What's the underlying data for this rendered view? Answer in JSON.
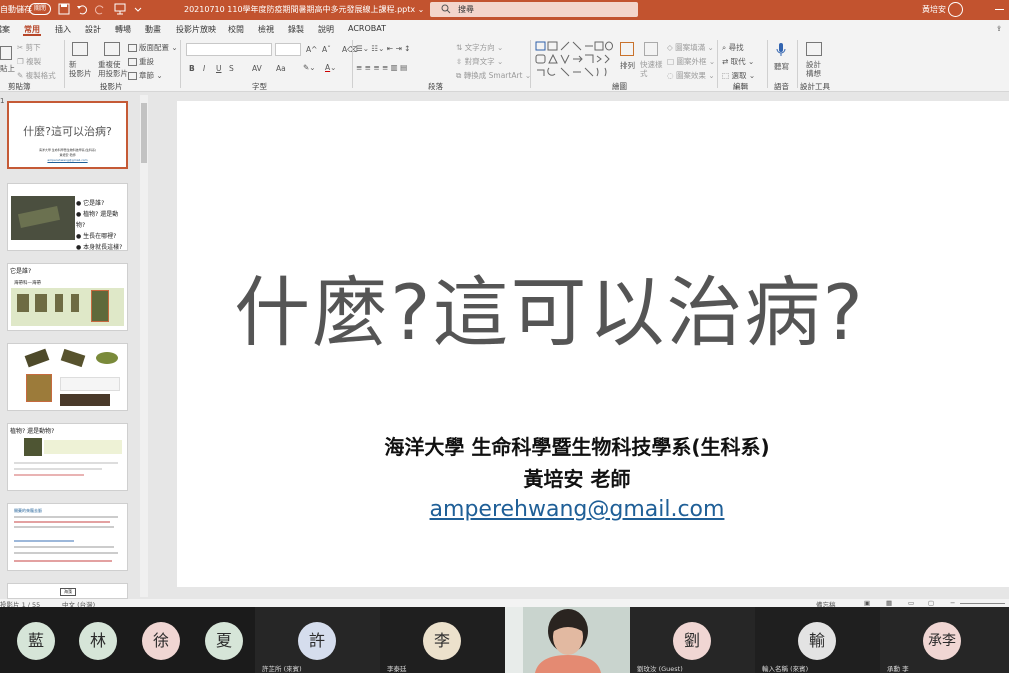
{
  "titlebar": {
    "autosave_label": "自動儲存",
    "autosave_state": "關閉",
    "document_title": "20210710 110學年度防疫期間暑期高中多元發展線上課程.pptx  ⌄",
    "search_placeholder": "搜尋",
    "user_name": "黃培安"
  },
  "tabs": [
    "檔案",
    "常用",
    "插入",
    "設計",
    "轉場",
    "動畫",
    "投影片放映",
    "校閱",
    "檢視",
    "錄製",
    "說明",
    "ACROBAT"
  ],
  "ribbon": {
    "clipboard": {
      "paste": "貼上",
      "cut": "剪下",
      "copy": "複製",
      "format_painter": "複製格式",
      "label": "剪貼簿"
    },
    "slides": {
      "new_slide": "新\n投影片",
      "reuse": "重複使\n用投影片",
      "layout": "版面配置",
      "reset": "重設",
      "section": "章節",
      "label": "投影片"
    },
    "font": {
      "bold": "B",
      "italic": "I",
      "underline": "U",
      "strike": "S",
      "spacing": "AV",
      "case": "Aa",
      "label": "字型"
    },
    "paragraph": {
      "text_direction": "文字方向",
      "align_text": "對齊文字",
      "smartart": "轉換成 SmartArt",
      "label": "段落"
    },
    "drawing": {
      "arrange": "排列",
      "quick_styles": "快速樣\n式",
      "fill": "圖案填滿",
      "outline": "圖案外框",
      "effects": "圖案效果",
      "label": "繪圖"
    },
    "editing": {
      "find": "尋找",
      "replace": "取代",
      "select": "選取",
      "label": "編輯"
    },
    "voice": {
      "dictate": "聽寫",
      "label": "語音"
    },
    "designer": {
      "ideas": "設計\n構想",
      "label": "設計工具"
    }
  },
  "thumbnails": [
    {
      "title": "什麼?這可以治病?",
      "note": "海洋大學 生命科學暨生物科技學系(生科系)",
      "note2": "黃培安 老師",
      "link": "amperehwang@gmail.com"
    },
    {
      "bullets": [
        "它是誰?",
        "植物? 還是動物?",
        "生長在哪裡?",
        "本身就長這樣?"
      ]
    },
    {
      "title": "它是誰?",
      "caption": "海帶科—海帶"
    },
    {
      "title": ""
    },
    {
      "title": "植物? 還是動物?"
    },
    {
      "title": "開藥的來龍去脈"
    },
    {
      "title": "海藻"
    }
  ],
  "slide": {
    "title": "什麼?這可以治病?",
    "line1": "海洋大學 生命科學暨生物科技學系(生科系)",
    "line2": "黃培安 老師",
    "email": "amperehwang@gmail.com"
  },
  "status": {
    "slide_count": "投影片 1 / 55",
    "language": "中文 (台灣)",
    "notes": "備忘稿"
  },
  "participants": [
    {
      "initial": "藍",
      "name": "",
      "color": "#d6e5d8"
    },
    {
      "initial": "林",
      "name": "",
      "color": "#d6e5d8"
    },
    {
      "initial": "徐",
      "name": "",
      "color": "#f0d6d3"
    },
    {
      "initial": "夏",
      "name": "",
      "color": "#d6e5d8"
    },
    {
      "initial": "許",
      "name": "許芷所 (來賓)",
      "color": "#d5dded"
    },
    {
      "initial": "李",
      "name": "李泰廷",
      "color": "#ece1cc"
    },
    {
      "initial": "劉",
      "name": "劉玟汝 (Guest)",
      "color": "#f0d6d3"
    },
    {
      "initial": "輸",
      "name": "輸入名稱 (來賓)",
      "color": "#e3e3e3"
    },
    {
      "initial": "承李",
      "name": "承勳 李",
      "color": "#f0d6d3"
    }
  ]
}
